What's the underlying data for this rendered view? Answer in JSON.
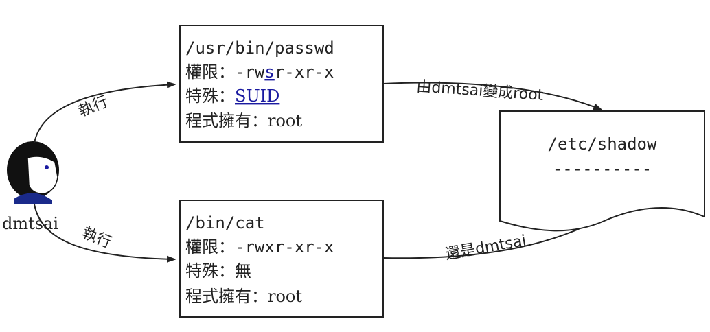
{
  "user": {
    "name": "dmtsai"
  },
  "passwd_box": {
    "path": "/usr/bin/passwd",
    "perm_label": "權限：",
    "perm_before": "-rw",
    "perm_special": "s",
    "perm_after": "r-xr-x",
    "special_label": "特殊：",
    "special_value": "SUID",
    "owner_label": "程式擁有：",
    "owner_value": "root"
  },
  "cat_box": {
    "path": "/bin/cat",
    "perm_label": "權限：",
    "perm_value": "-rwxr-xr-x",
    "special_label": "特殊：",
    "special_value": "無",
    "owner_label": "程式擁有：",
    "owner_value": "root"
  },
  "shadow_doc": {
    "path": "/etc/shadow",
    "dashes": "----------"
  },
  "arrows": {
    "exec_top": "執行",
    "exec_bottom": "執行",
    "suid_change": "由dmtsai變成root",
    "stays": "還是dmtsai"
  },
  "colors": {
    "line": "#222222",
    "highlight": "#1a1aa0",
    "hair": "#111111",
    "shirt": "#1a2a8a",
    "skin": "#ffffff"
  }
}
